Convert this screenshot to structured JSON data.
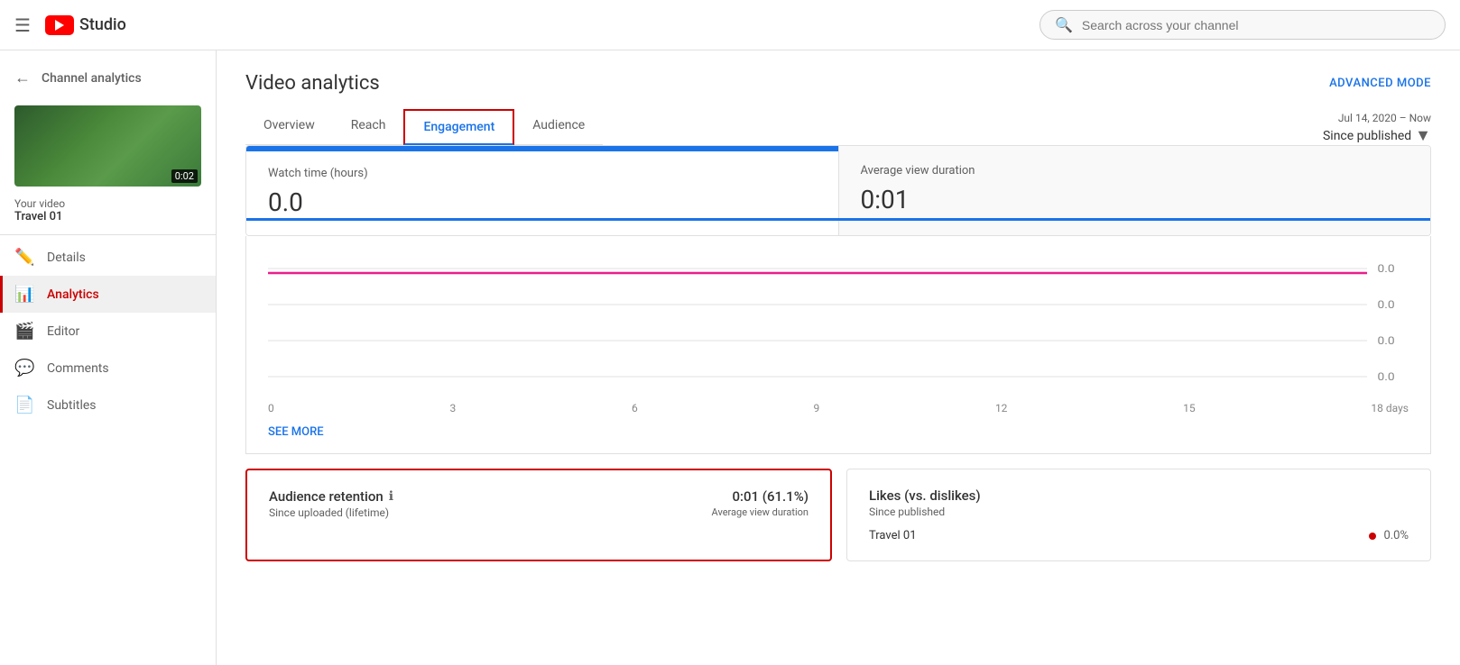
{
  "header": {
    "hamburger_label": "☰",
    "logo_text": "Studio",
    "search_placeholder": "Search across your channel"
  },
  "sidebar": {
    "back_label": "Channel analytics",
    "video": {
      "duration": "0:02",
      "your_video_label": "Your video",
      "title": "Travel 01"
    },
    "items": [
      {
        "id": "details",
        "label": "Details",
        "icon": "✏️"
      },
      {
        "id": "analytics",
        "label": "Analytics",
        "icon": "📊",
        "active": true
      },
      {
        "id": "editor",
        "label": "Editor",
        "icon": "🎬"
      },
      {
        "id": "comments",
        "label": "Comments",
        "icon": "💬"
      },
      {
        "id": "subtitles",
        "label": "Subtitles",
        "icon": "📄"
      }
    ]
  },
  "content": {
    "page_title": "Video analytics",
    "advanced_mode_label": "ADVANCED MODE",
    "tabs": [
      {
        "id": "overview",
        "label": "Overview",
        "active": false
      },
      {
        "id": "reach",
        "label": "Reach",
        "active": false
      },
      {
        "id": "engagement",
        "label": "Engagement",
        "active": true
      },
      {
        "id": "audience",
        "label": "Audience",
        "active": false
      }
    ],
    "date_range": {
      "range_text": "Jul 14, 2020 – Now",
      "period_label": "Since published"
    },
    "metrics": [
      {
        "id": "watch-time",
        "label": "Watch time (hours)",
        "value": "0.0",
        "active": true
      },
      {
        "id": "avg-view-duration",
        "label": "Average view duration",
        "value": "0:01",
        "active": false
      }
    ],
    "chart": {
      "x_labels": [
        "0",
        "3",
        "6",
        "9",
        "12",
        "15",
        "18 days"
      ],
      "y_labels": [
        "0.0",
        "0.0",
        "0.0",
        "0.0"
      ],
      "line_color": "#e91e8c"
    },
    "see_more_label": "SEE MORE",
    "bottom_cards": [
      {
        "id": "audience-retention",
        "title": "Audience retention",
        "subtitle": "Since uploaded (lifetime)",
        "value": "0:01 (61.1%)",
        "value_sub": "Average view duration",
        "highlighted": true
      },
      {
        "id": "likes-dislikes",
        "title": "Likes (vs. dislikes)",
        "subtitle": "Since published",
        "rows": [
          {
            "name": "Travel 01",
            "pct": "0.0%"
          }
        ],
        "highlighted": false
      }
    ]
  }
}
